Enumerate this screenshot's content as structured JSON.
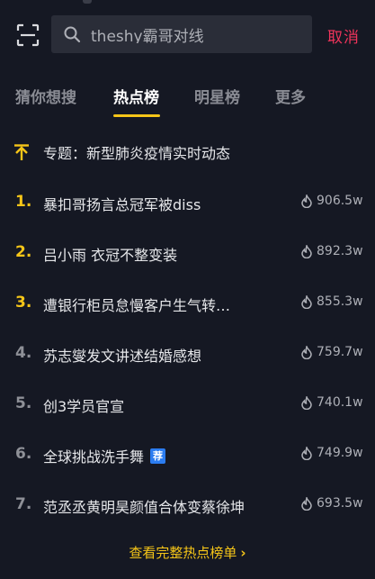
{
  "search": {
    "value": "theshy霸哥对线",
    "cancel_label": "取消"
  },
  "tabs": [
    {
      "label": "猜你想搜"
    },
    {
      "label": "热点榜"
    },
    {
      "label": "明星榜"
    },
    {
      "label": "更多"
    }
  ],
  "active_tab": "热点榜",
  "topic": {
    "label": "专题：新型肺炎疫情实时动态",
    "icon": "arrow-up-topic-icon"
  },
  "hot_list": [
    {
      "rank": "1.",
      "title": "暴扣哥扬言总冠军被diss",
      "heat": "906.5w"
    },
    {
      "rank": "2.",
      "title": "吕小雨 衣冠不整变装",
      "heat": "892.3w"
    },
    {
      "rank": "3.",
      "title": "遭银行柜员怠慢客户生气转…",
      "heat": "855.3w"
    },
    {
      "rank": "4.",
      "title": "苏志燮发文讲述结婚感想",
      "heat": "759.7w"
    },
    {
      "rank": "5.",
      "title": "创3学员官宣",
      "heat": "740.1w"
    },
    {
      "rank": "6.",
      "title": "全球挑战洗手舞",
      "heat": "749.9w",
      "badge": "荐"
    },
    {
      "rank": "7.",
      "title": "范丞丞黄明昊颜值合体变蔡徐坤",
      "heat": "693.5w"
    }
  ],
  "footer_link": "查看完整热点榜单",
  "colors": {
    "background": "#151823",
    "accent_yellow": "#f5c518",
    "cancel_red": "#f0345b",
    "badge_blue": "#2b7cf0"
  }
}
